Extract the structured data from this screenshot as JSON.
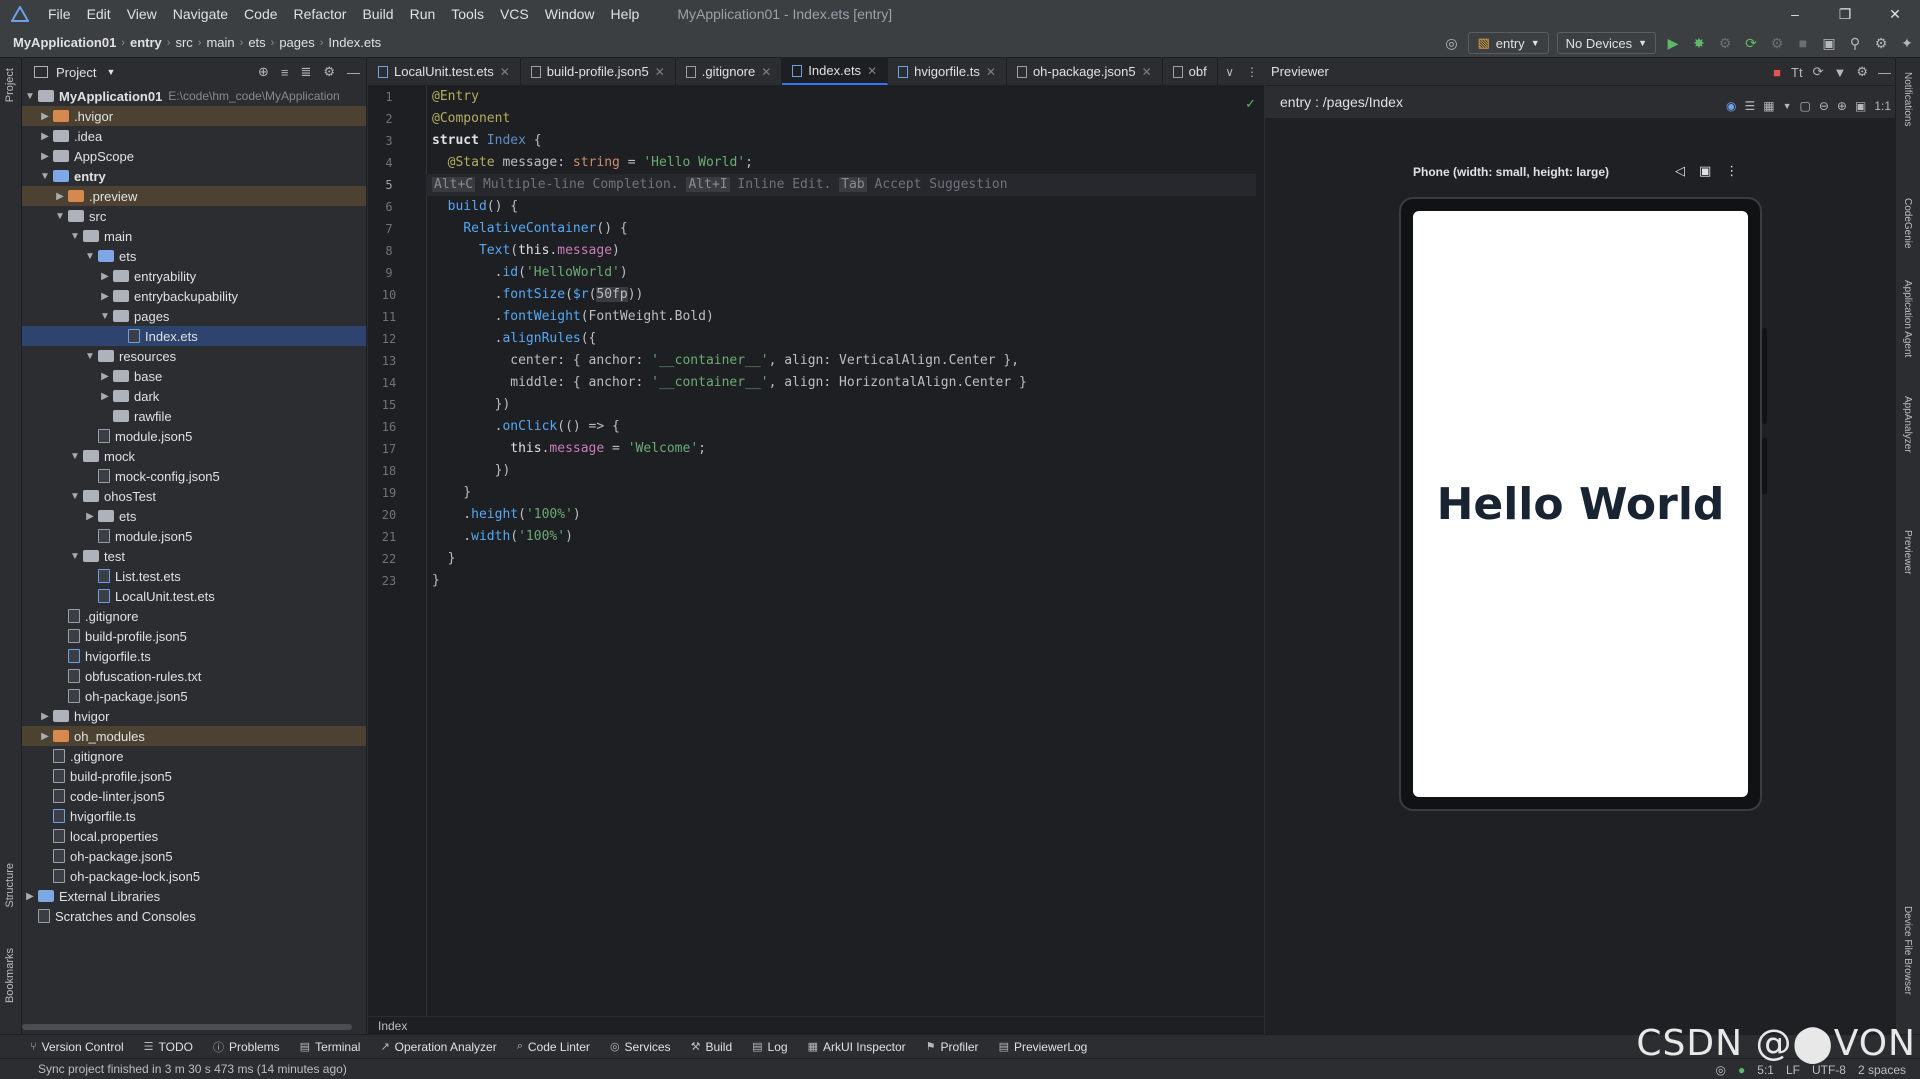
{
  "menubar": {
    "items": [
      "File",
      "Edit",
      "View",
      "Navigate",
      "Code",
      "Refactor",
      "Build",
      "Run",
      "Tools",
      "VCS",
      "Window",
      "Help"
    ],
    "title": "MyApplication01 - Index.ets [entry]"
  },
  "navbar": {
    "crumbs": [
      "MyApplication01",
      "entry",
      "src",
      "main",
      "ets",
      "pages",
      "Index.ets"
    ],
    "module_combo": "entry",
    "device_combo": "No Devices"
  },
  "project": {
    "title": "Project",
    "root_name": "MyApplication01",
    "root_path": "E:\\code\\hm_code\\MyApplication",
    "items": [
      {
        "label": ".hvigor",
        "kind": "folder-orange",
        "indent": 1,
        "arrow": "right",
        "hl": true
      },
      {
        "label": ".idea",
        "kind": "folder",
        "indent": 1,
        "arrow": "right"
      },
      {
        "label": "AppScope",
        "kind": "folder",
        "indent": 1,
        "arrow": "right"
      },
      {
        "label": "entry",
        "kind": "folder-blue",
        "indent": 1,
        "arrow": "down",
        "bold": true
      },
      {
        "label": ".preview",
        "kind": "folder-orange",
        "indent": 2,
        "arrow": "right",
        "hl": true
      },
      {
        "label": "src",
        "kind": "folder",
        "indent": 2,
        "arrow": "down"
      },
      {
        "label": "main",
        "kind": "folder",
        "indent": 3,
        "arrow": "down"
      },
      {
        "label": "ets",
        "kind": "folder-blue",
        "indent": 4,
        "arrow": "down"
      },
      {
        "label": "entryability",
        "kind": "folder",
        "indent": 5,
        "arrow": "right"
      },
      {
        "label": "entrybackupability",
        "kind": "folder",
        "indent": 5,
        "arrow": "right"
      },
      {
        "label": "pages",
        "kind": "folder",
        "indent": 5,
        "arrow": "down"
      },
      {
        "label": "Index.ets",
        "kind": "file-ts",
        "indent": 6,
        "arrow": "",
        "sel": true
      },
      {
        "label": "resources",
        "kind": "folder",
        "indent": 4,
        "arrow": "down"
      },
      {
        "label": "base",
        "kind": "folder",
        "indent": 5,
        "arrow": "right"
      },
      {
        "label": "dark",
        "kind": "folder",
        "indent": 5,
        "arrow": "right"
      },
      {
        "label": "rawfile",
        "kind": "folder",
        "indent": 5,
        "arrow": ""
      },
      {
        "label": "module.json5",
        "kind": "file",
        "indent": 4,
        "arrow": ""
      },
      {
        "label": "mock",
        "kind": "folder",
        "indent": 3,
        "arrow": "down"
      },
      {
        "label": "mock-config.json5",
        "kind": "file",
        "indent": 4,
        "arrow": ""
      },
      {
        "label": "ohosTest",
        "kind": "folder",
        "indent": 3,
        "arrow": "down"
      },
      {
        "label": "ets",
        "kind": "folder",
        "indent": 4,
        "arrow": "right"
      },
      {
        "label": "module.json5",
        "kind": "file",
        "indent": 4,
        "arrow": ""
      },
      {
        "label": "test",
        "kind": "folder",
        "indent": 3,
        "arrow": "down"
      },
      {
        "label": "List.test.ets",
        "kind": "file-ts",
        "indent": 4,
        "arrow": ""
      },
      {
        "label": "LocalUnit.test.ets",
        "kind": "file-ts",
        "indent": 4,
        "arrow": ""
      },
      {
        "label": ".gitignore",
        "kind": "file",
        "indent": 2,
        "arrow": ""
      },
      {
        "label": "build-profile.json5",
        "kind": "file",
        "indent": 2,
        "arrow": ""
      },
      {
        "label": "hvigorfile.ts",
        "kind": "file-ts",
        "indent": 2,
        "arrow": ""
      },
      {
        "label": "obfuscation-rules.txt",
        "kind": "file",
        "indent": 2,
        "arrow": ""
      },
      {
        "label": "oh-package.json5",
        "kind": "file",
        "indent": 2,
        "arrow": ""
      },
      {
        "label": "hvigor",
        "kind": "folder",
        "indent": 1,
        "arrow": "right"
      },
      {
        "label": "oh_modules",
        "kind": "folder-orange",
        "indent": 1,
        "arrow": "right",
        "hl": true
      },
      {
        "label": ".gitignore",
        "kind": "file",
        "indent": 1,
        "arrow": ""
      },
      {
        "label": "build-profile.json5",
        "kind": "file",
        "indent": 1,
        "arrow": ""
      },
      {
        "label": "code-linter.json5",
        "kind": "file",
        "indent": 1,
        "arrow": ""
      },
      {
        "label": "hvigorfile.ts",
        "kind": "file-ts",
        "indent": 1,
        "arrow": ""
      },
      {
        "label": "local.properties",
        "kind": "file",
        "indent": 1,
        "arrow": ""
      },
      {
        "label": "oh-package.json5",
        "kind": "file",
        "indent": 1,
        "arrow": ""
      },
      {
        "label": "oh-package-lock.json5",
        "kind": "file",
        "indent": 1,
        "arrow": ""
      },
      {
        "label": "External Libraries",
        "kind": "lib",
        "indent": 0,
        "arrow": "right"
      },
      {
        "label": "Scratches and Consoles",
        "kind": "scratch",
        "indent": 0,
        "arrow": ""
      }
    ]
  },
  "editor": {
    "tabs": [
      {
        "label": "LocalUnit.test.ets",
        "active": false
      },
      {
        "label": "build-profile.json5",
        "active": false
      },
      {
        "label": ".gitignore",
        "active": false
      },
      {
        "label": "Index.ets",
        "active": true
      },
      {
        "label": "hvigorfile.ts",
        "active": false
      },
      {
        "label": "oh-package.json5",
        "active": false
      },
      {
        "label": "obf",
        "active": false
      }
    ],
    "line_numbers": [
      "1",
      "2",
      "3",
      "4",
      "5",
      "6",
      "7",
      "8",
      "9",
      "10",
      "11",
      "12",
      "13",
      "14",
      "15",
      "16",
      "17",
      "18",
      "19",
      "20",
      "21",
      "22",
      "23"
    ],
    "current_line": 5,
    "footer": "Index"
  },
  "previewer": {
    "title": "Previewer",
    "route": "entry : /pages/Index",
    "device_label": "Phone (width: small, height: large)",
    "screen_text": "Hello World"
  },
  "bottombar": {
    "items": [
      "Version Control",
      "TODO",
      "Problems",
      "Terminal",
      "Operation Analyzer",
      "Code Linter",
      "Services",
      "Build",
      "Log",
      "ArkUI Inspector",
      "Profiler",
      "PreviewerLog"
    ]
  },
  "status": {
    "message": "Sync project finished in 3 m 30 s 473 ms (14 minutes ago)",
    "position": "5:1",
    "line_sep": "LF",
    "encoding": "UTF-8",
    "indent": "2 spaces"
  },
  "stripes": {
    "left": [
      "Project",
      "Structure",
      "Bookmarks"
    ],
    "right": [
      "Notifications",
      "CodeGenie",
      "Application Agent",
      "AppAnalyzer",
      "Previewer",
      "Device File Browser"
    ]
  },
  "watermark": "CSDN @⬤VON",
  "colors": {
    "accent": "#3574f0",
    "selection": "#2e436e",
    "highlight": "#4d4232"
  }
}
